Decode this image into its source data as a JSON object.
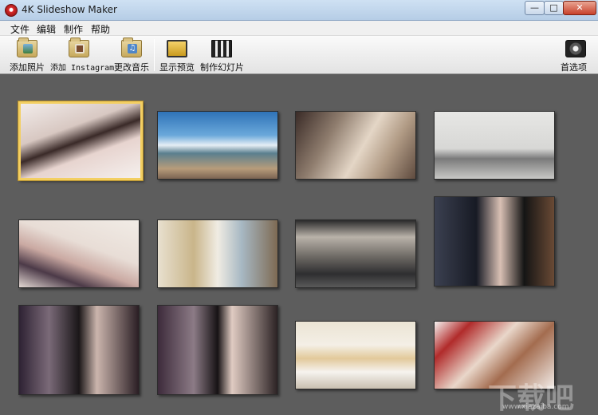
{
  "window": {
    "title": "4K Slideshow Maker",
    "min": "—",
    "max": "□",
    "close": "✕"
  },
  "menu": [
    "文件",
    "编辑",
    "制作",
    "帮助"
  ],
  "toolbar": {
    "add_photos": "添加照片",
    "add_instagram": "添加 Instagram",
    "change_music": "更改音乐",
    "show_preview": "显示预览",
    "make_slideshow": "制作幻灯片",
    "preferences": "首选项"
  },
  "photos": [
    {
      "name": "photo-1",
      "selected": true
    },
    {
      "name": "photo-2",
      "selected": false
    },
    {
      "name": "photo-3",
      "selected": false
    },
    {
      "name": "photo-4",
      "selected": false
    },
    {
      "name": "photo-5",
      "selected": false
    },
    {
      "name": "photo-6",
      "selected": false
    },
    {
      "name": "photo-7",
      "selected": false
    },
    {
      "name": "photo-8",
      "selected": false
    },
    {
      "name": "photo-9",
      "selected": false
    },
    {
      "name": "photo-10",
      "selected": false
    },
    {
      "name": "photo-11",
      "selected": false
    },
    {
      "name": "photo-12",
      "selected": false
    }
  ],
  "watermark": {
    "text": "下载吧",
    "sub": "www.xiazaiba.com"
  },
  "colors": {
    "selection": "#f3cf62",
    "background": "#5d5d5d",
    "close_button": "#c8412b"
  }
}
